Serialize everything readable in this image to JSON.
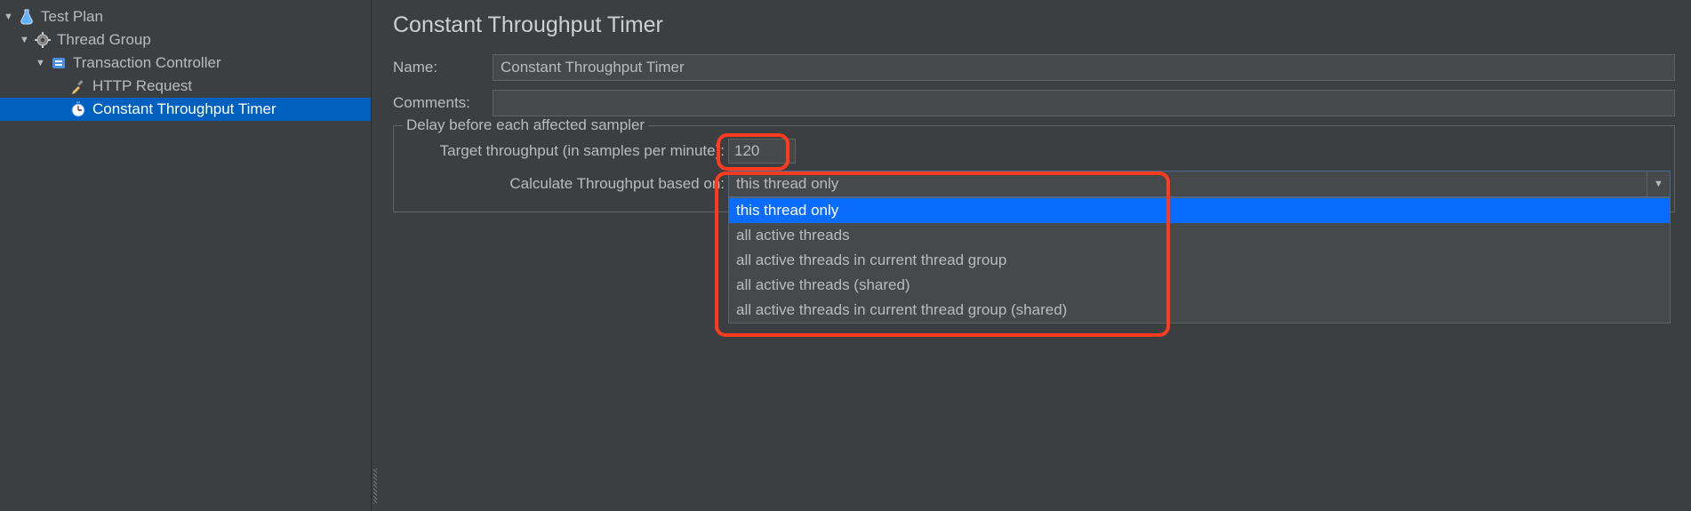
{
  "tree": {
    "test_plan": "Test Plan",
    "thread_group": "Thread Group",
    "transaction_controller": "Transaction Controller",
    "http_request": "HTTP Request",
    "constant_throughput_timer": "Constant Throughput Timer"
  },
  "panel": {
    "title": "Constant Throughput Timer",
    "name_label": "Name:",
    "name_value": "Constant Throughput Timer",
    "comments_label": "Comments:",
    "comments_value": "",
    "fieldset_legend": "Delay before each affected sampler",
    "target_label": "Target throughput (in samples per minute):",
    "target_value": "120",
    "calc_label": "Calculate Throughput based on:",
    "calc_selected": "this thread only",
    "calc_options": [
      "this thread only",
      "all active threads",
      "all active threads in current thread group",
      "all active threads (shared)",
      "all active threads in current thread group (shared)"
    ]
  }
}
